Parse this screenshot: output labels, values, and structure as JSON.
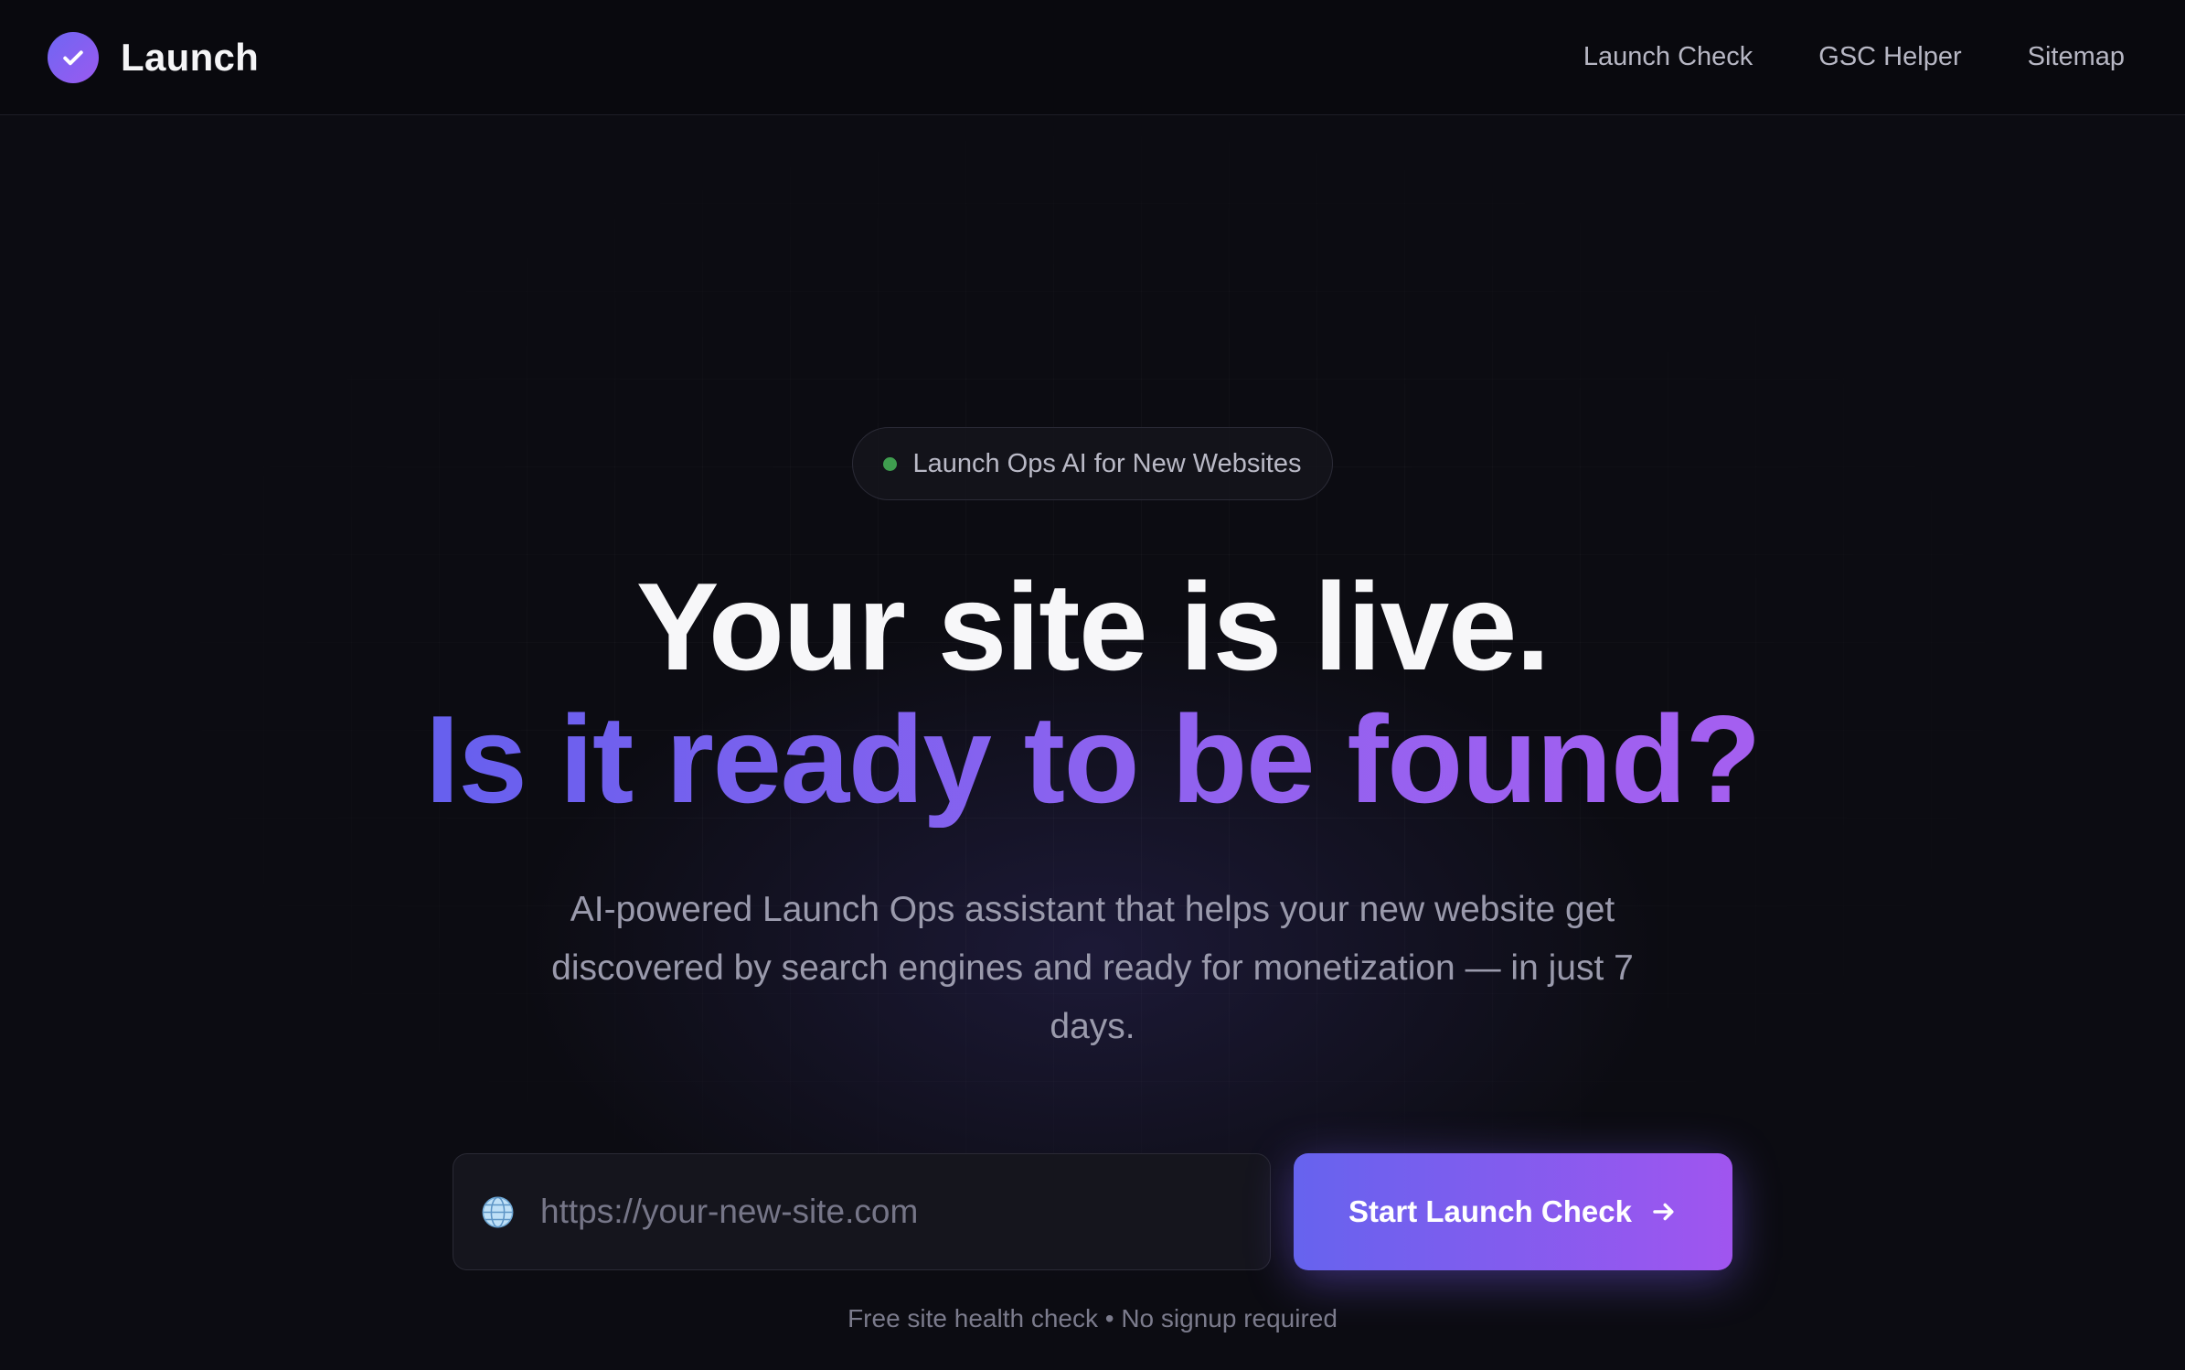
{
  "header": {
    "brand_name": "Launch",
    "nav": [
      {
        "label": "Launch Check"
      },
      {
        "label": "GSC Helper"
      },
      {
        "label": "Sitemap"
      }
    ]
  },
  "hero": {
    "badge": "Launch Ops AI for New Websites",
    "title_line1": "Your site is live.",
    "title_line2": "Is it ready to be found?",
    "subtitle": "AI-powered Launch Ops assistant that helps your new website get discovered by search engines and ready for monetization — in just 7 days.",
    "url_input": {
      "placeholder": "https://your-new-site.com",
      "value": ""
    },
    "cta_label": "Start Launch Check",
    "note": "Free site health check • No signup required"
  },
  "icons": {
    "brand": "check-circle-icon",
    "badge": "status-dot-icon",
    "url": "globe-icon",
    "cta": "arrow-right-icon"
  },
  "colors": {
    "background": "#0c0c12",
    "accent_start": "#6663ee",
    "accent_end": "#a055ef",
    "status_green": "#3f9d4f"
  }
}
